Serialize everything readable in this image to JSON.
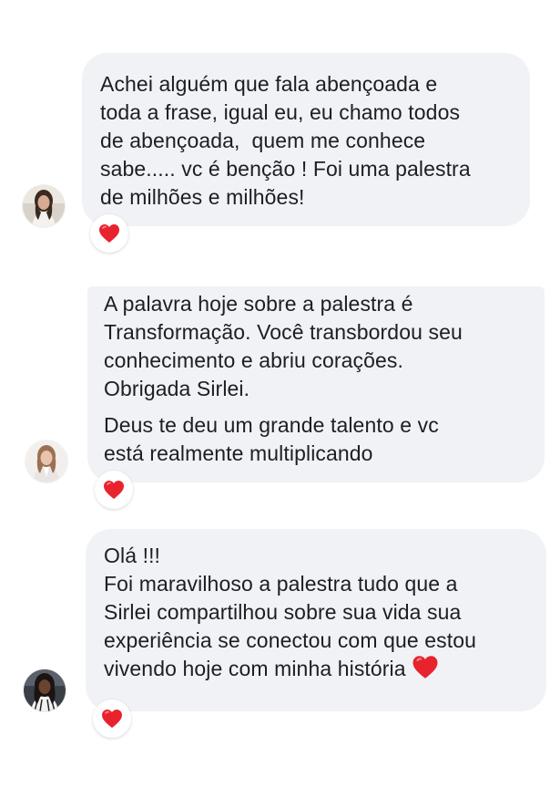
{
  "comments": [
    {
      "author_avatar": "woman-dark-hair-photo",
      "lines": [
        "Achei alguém que fala abençoada e",
        "toda a frase, igual eu, eu chamo todos",
        "de abençoada,  quem me conhece",
        "sabe..... vc é benção ! Foi uma palestra",
        "de milhões e milhões!"
      ],
      "reaction": "red-heart-icon"
    },
    {
      "author_avatar": "woman-light-hair-photo",
      "lines": [
        "A palavra hoje sobre a palestra é",
        "Transformação. Você transbordou seu",
        "conhecimento e abriu corações.",
        "Obrigada Sirlei."
      ],
      "lines_b": [
        "Deus te deu um grande talento e vc",
        "está realmente multiplicando"
      ],
      "reaction": "red-heart-icon"
    },
    {
      "author_avatar": "woman-dark-skin-photo",
      "lines": [
        "Olá !!!",
        "Foi maravilhoso a palestra tudo que a",
        "Sirlei compartilhou sobre sua vida sua",
        "experiência se conectou com que estou",
        "vivendo hoje com minha história"
      ],
      "inline_emoji": "red-heart-icon",
      "reaction": "red-heart-icon"
    }
  ],
  "colors": {
    "bubble": "#f0f2f5",
    "text": "#1c1e21",
    "heart": "#e8232e"
  }
}
